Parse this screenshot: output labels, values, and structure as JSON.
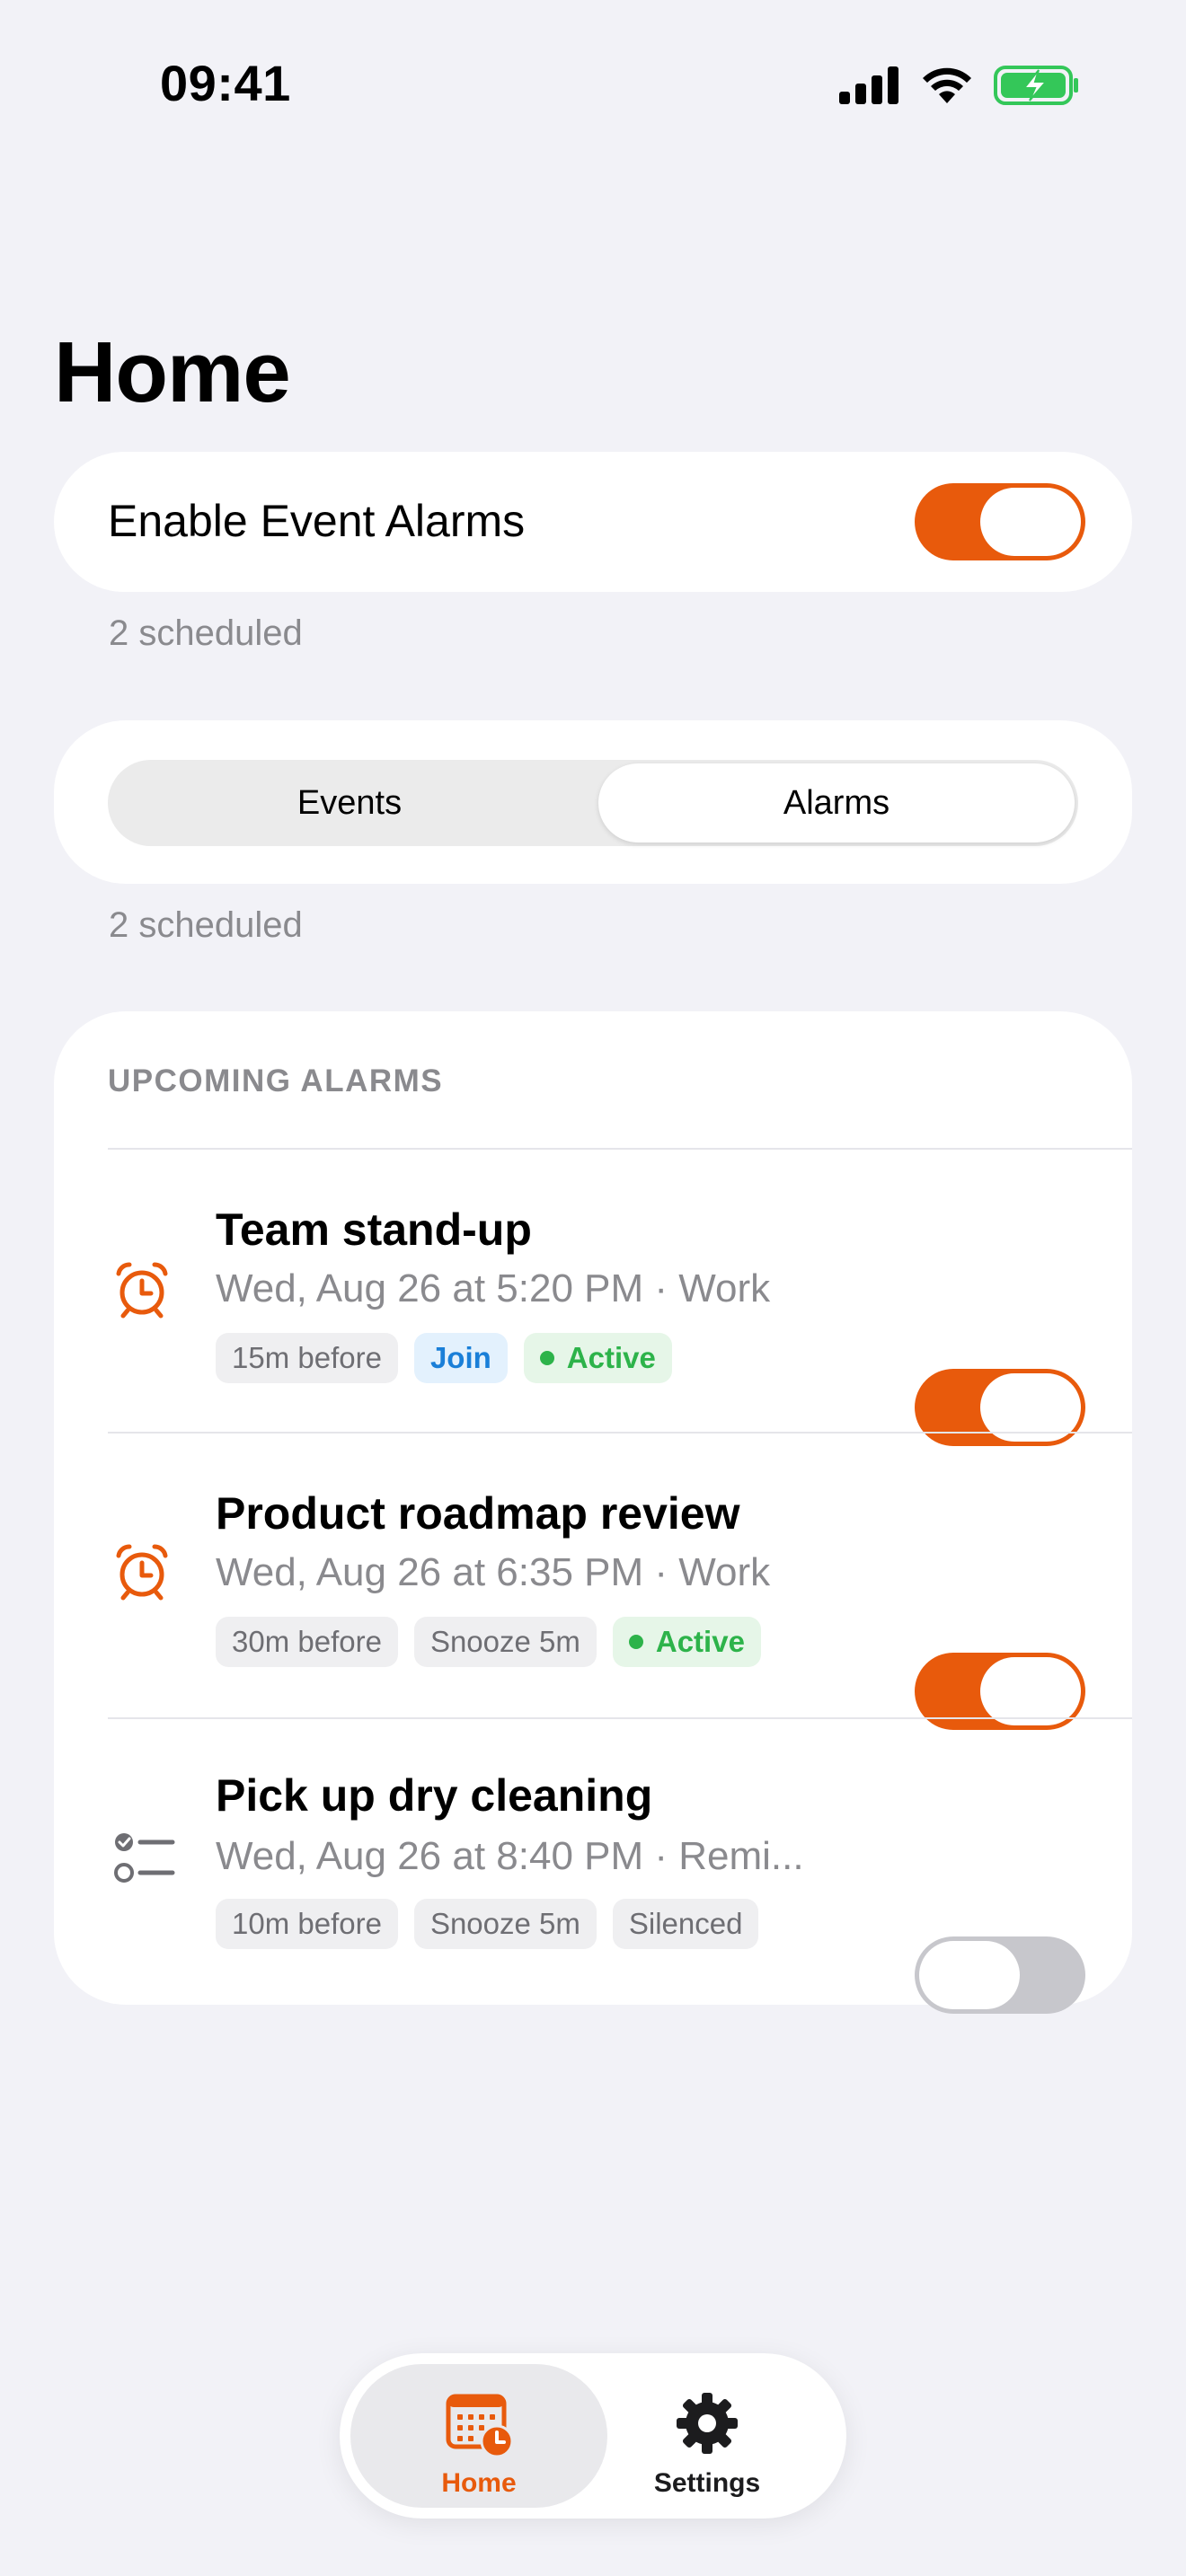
{
  "status_bar": {
    "time": "09:41",
    "icons": [
      "signal-icon",
      "wifi-icon",
      "battery-charging-icon"
    ]
  },
  "page": {
    "title": "Home"
  },
  "enable_alarms": {
    "label": "Enable Event Alarms",
    "enabled": true,
    "caption": "2 scheduled"
  },
  "segmented": {
    "options": [
      "Events",
      "Alarms"
    ],
    "selected": "Alarms",
    "caption": "2 scheduled"
  },
  "upcoming": {
    "header": "UPCOMING ALARMS",
    "items": [
      {
        "icon": "alarm-clock-icon",
        "title": "Team stand-up",
        "subtitle": "Wed, Aug 26 at 5:20 PM · Work",
        "chips": [
          "15m before",
          "Join",
          "Active"
        ],
        "enabled": true
      },
      {
        "icon": "alarm-clock-icon",
        "title": "Product roadmap review",
        "subtitle": "Wed, Aug 26 at 6:35 PM · Work",
        "chips": [
          "30m before",
          "Snooze 5m",
          "Active"
        ],
        "enabled": true
      },
      {
        "icon": "checklist-icon",
        "title": "Pick up dry cleaning",
        "subtitle": "Wed, Aug 26 at 8:40 PM · Remi...",
        "chips": [
          "10m before",
          "Snooze 5m",
          "Silenced"
        ],
        "enabled": false
      }
    ]
  },
  "tab_bar": {
    "tabs": [
      {
        "label": "Home",
        "icon": "calendar-clock-icon",
        "selected": true
      },
      {
        "label": "Settings",
        "icon": "gear-icon",
        "selected": false
      }
    ]
  },
  "colors": {
    "accent": "#E85A0C",
    "active_green": "#2DB34A",
    "join_blue": "#1A7FD8",
    "background": "#F2F2F7"
  }
}
